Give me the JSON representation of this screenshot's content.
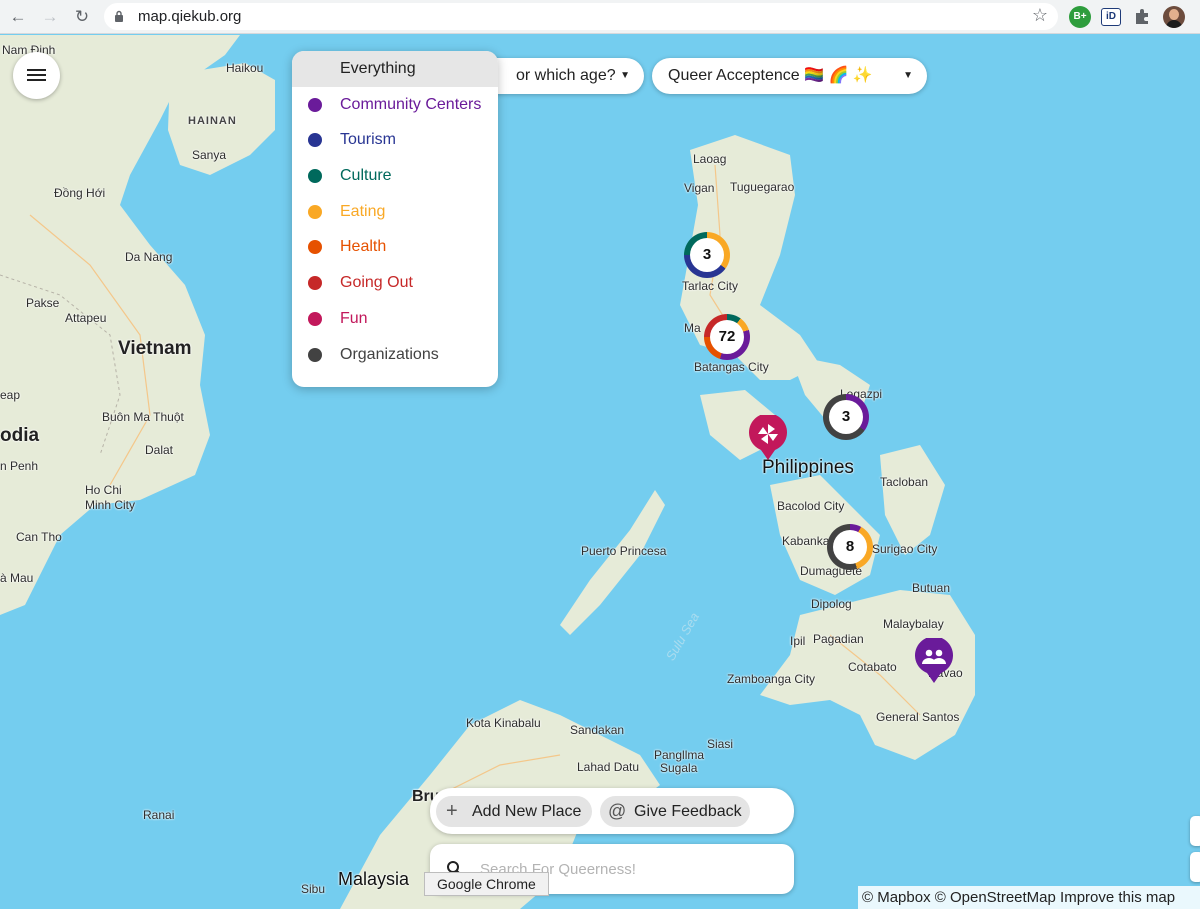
{
  "browser": {
    "url": "map.qiekub.org",
    "back_icon": "←",
    "forward_icon": "→",
    "reload_icon": "↻",
    "bookmark_icon": "☆",
    "extensions": [
      {
        "label": "B+",
        "color": "#2e9d3d"
      },
      {
        "label": "iD",
        "color": "#1e3a78"
      },
      {
        "label": "",
        "icon": "puzzle-icon"
      }
    ]
  },
  "filters": {
    "age_label": "or which age?",
    "acceptance_label": "Queer Acceptence 🏳️‍🌈 🌈 ✨"
  },
  "category_menu": {
    "items": [
      {
        "label": "Everything",
        "color": "#222222",
        "selected": true
      },
      {
        "label": "Community Centers",
        "color": "#6a1b9a"
      },
      {
        "label": "Tourism",
        "color": "#283593"
      },
      {
        "label": "Culture",
        "color": "#00695c"
      },
      {
        "label": "Eating",
        "color": "#f9a825"
      },
      {
        "label": "Health",
        "color": "#e65100"
      },
      {
        "label": "Going Out",
        "color": "#c62828"
      },
      {
        "label": "Fun",
        "color": "#c2185b"
      },
      {
        "label": "Organizations",
        "color": "#424242"
      }
    ]
  },
  "map": {
    "places": [
      {
        "name": "Nam Định"
      },
      {
        "name": "Haikou"
      },
      {
        "name": "HAINAN"
      },
      {
        "name": "Sanya"
      },
      {
        "name": "Đồng Hới"
      },
      {
        "name": "Da Nang"
      },
      {
        "name": "Pakse"
      },
      {
        "name": "Attapeu"
      },
      {
        "name": "Vietnam"
      },
      {
        "name": "eap"
      },
      {
        "name": "Buôn Ma Thuột"
      },
      {
        "name": "odia"
      },
      {
        "name": "Dalat"
      },
      {
        "name": "n Penh"
      },
      {
        "name": "Ho Chi"
      },
      {
        "name": "Minh City"
      },
      {
        "name": "Can Tho"
      },
      {
        "name": "à Mau"
      },
      {
        "name": "Laoag"
      },
      {
        "name": "Vigan"
      },
      {
        "name": "Tuguegarao"
      },
      {
        "name": "Tarlac City"
      },
      {
        "name": "Ma"
      },
      {
        "name": "Batangas City"
      },
      {
        "name": "Legazpi"
      },
      {
        "name": "Philippines"
      },
      {
        "name": "Tacloban"
      },
      {
        "name": "Bacolod City"
      },
      {
        "name": "Kabankala"
      },
      {
        "name": "Dumaguete"
      },
      {
        "name": "Surigao City"
      },
      {
        "name": "Puerto Princesa"
      },
      {
        "name": "Butuan"
      },
      {
        "name": "Dipolog"
      },
      {
        "name": "Malaybalay"
      },
      {
        "name": "Ipil"
      },
      {
        "name": "Pagadian"
      },
      {
        "name": "Cotabato"
      },
      {
        "name": "Davao"
      },
      {
        "name": "Zamboanga City"
      },
      {
        "name": "General Santos"
      },
      {
        "name": "Sulu Sea"
      },
      {
        "name": "Kota Kinabalu"
      },
      {
        "name": "Sandakan"
      },
      {
        "name": "Siasi"
      },
      {
        "name": "Pangllma"
      },
      {
        "name": "Sugala"
      },
      {
        "name": "Lahad Datu"
      },
      {
        "name": "Ranai"
      },
      {
        "name": "Bru"
      },
      {
        "name": "Malaysia"
      },
      {
        "name": "Sibu"
      }
    ],
    "clusters": [
      {
        "count": "3",
        "colors": [
          "#f9a825",
          "#283593",
          "#00695c"
        ]
      },
      {
        "count": "72",
        "colors": [
          "#6a1b9a",
          "#e65100",
          "#c62828",
          "#00695c",
          "#f9a825"
        ]
      },
      {
        "count": "3",
        "colors": [
          "#6a1b9a",
          "#424242"
        ]
      },
      {
        "count": "8",
        "colors": [
          "#f9a825",
          "#424242",
          "#6a1b9a"
        ]
      }
    ],
    "pins": [
      {
        "category": "Fun",
        "icon": "pinwheel-icon",
        "color": "#c2185b"
      },
      {
        "category": "Community Centers",
        "icon": "group-icon",
        "color": "#6a1b9a"
      }
    ]
  },
  "actions": {
    "add_place_label": "Add New Place",
    "feedback_label": "Give Feedback"
  },
  "search": {
    "placeholder": "Search For Queerness!"
  },
  "tooltip": "Google Chrome",
  "attribution": "© Mapbox © OpenStreetMap  Improve this map"
}
